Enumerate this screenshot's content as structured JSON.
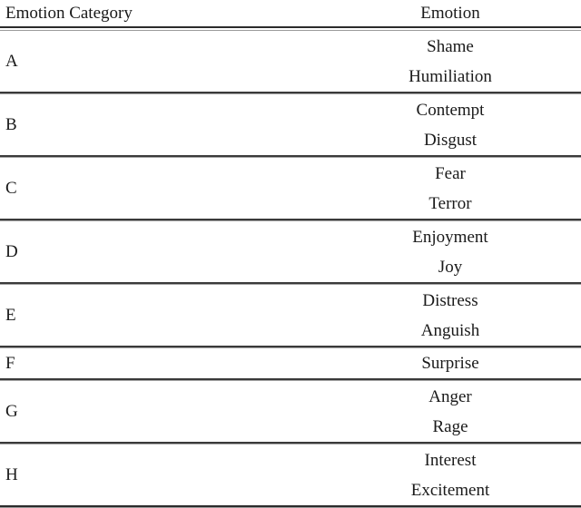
{
  "table": {
    "columns": [
      {
        "key": "category",
        "label": "Emotion Category",
        "align": "left"
      },
      {
        "key": "emotion",
        "label": "Emotion",
        "align": "center"
      }
    ],
    "rows": [
      {
        "category": "A",
        "emotions": [
          "Shame",
          "Humiliation"
        ]
      },
      {
        "category": "B",
        "emotions": [
          "Contempt",
          "Disgust"
        ]
      },
      {
        "category": "C",
        "emotions": [
          "Fear",
          "Terror"
        ]
      },
      {
        "category": "D",
        "emotions": [
          "Enjoyment",
          "Joy"
        ]
      },
      {
        "category": "E",
        "emotions": [
          "Distress",
          "Anguish"
        ]
      },
      {
        "category": "F",
        "emotions": [
          "Surprise"
        ]
      },
      {
        "category": "G",
        "emotions": [
          "Anger",
          "Rage"
        ]
      },
      {
        "category": "H",
        "emotions": [
          "Interest",
          "Excitement"
        ]
      }
    ]
  },
  "style": {
    "text_color": "#1a1a1a",
    "rule_color": "#2b2b2b",
    "rule_secondary_color": "#9a9a9a",
    "background": "#ffffff"
  }
}
